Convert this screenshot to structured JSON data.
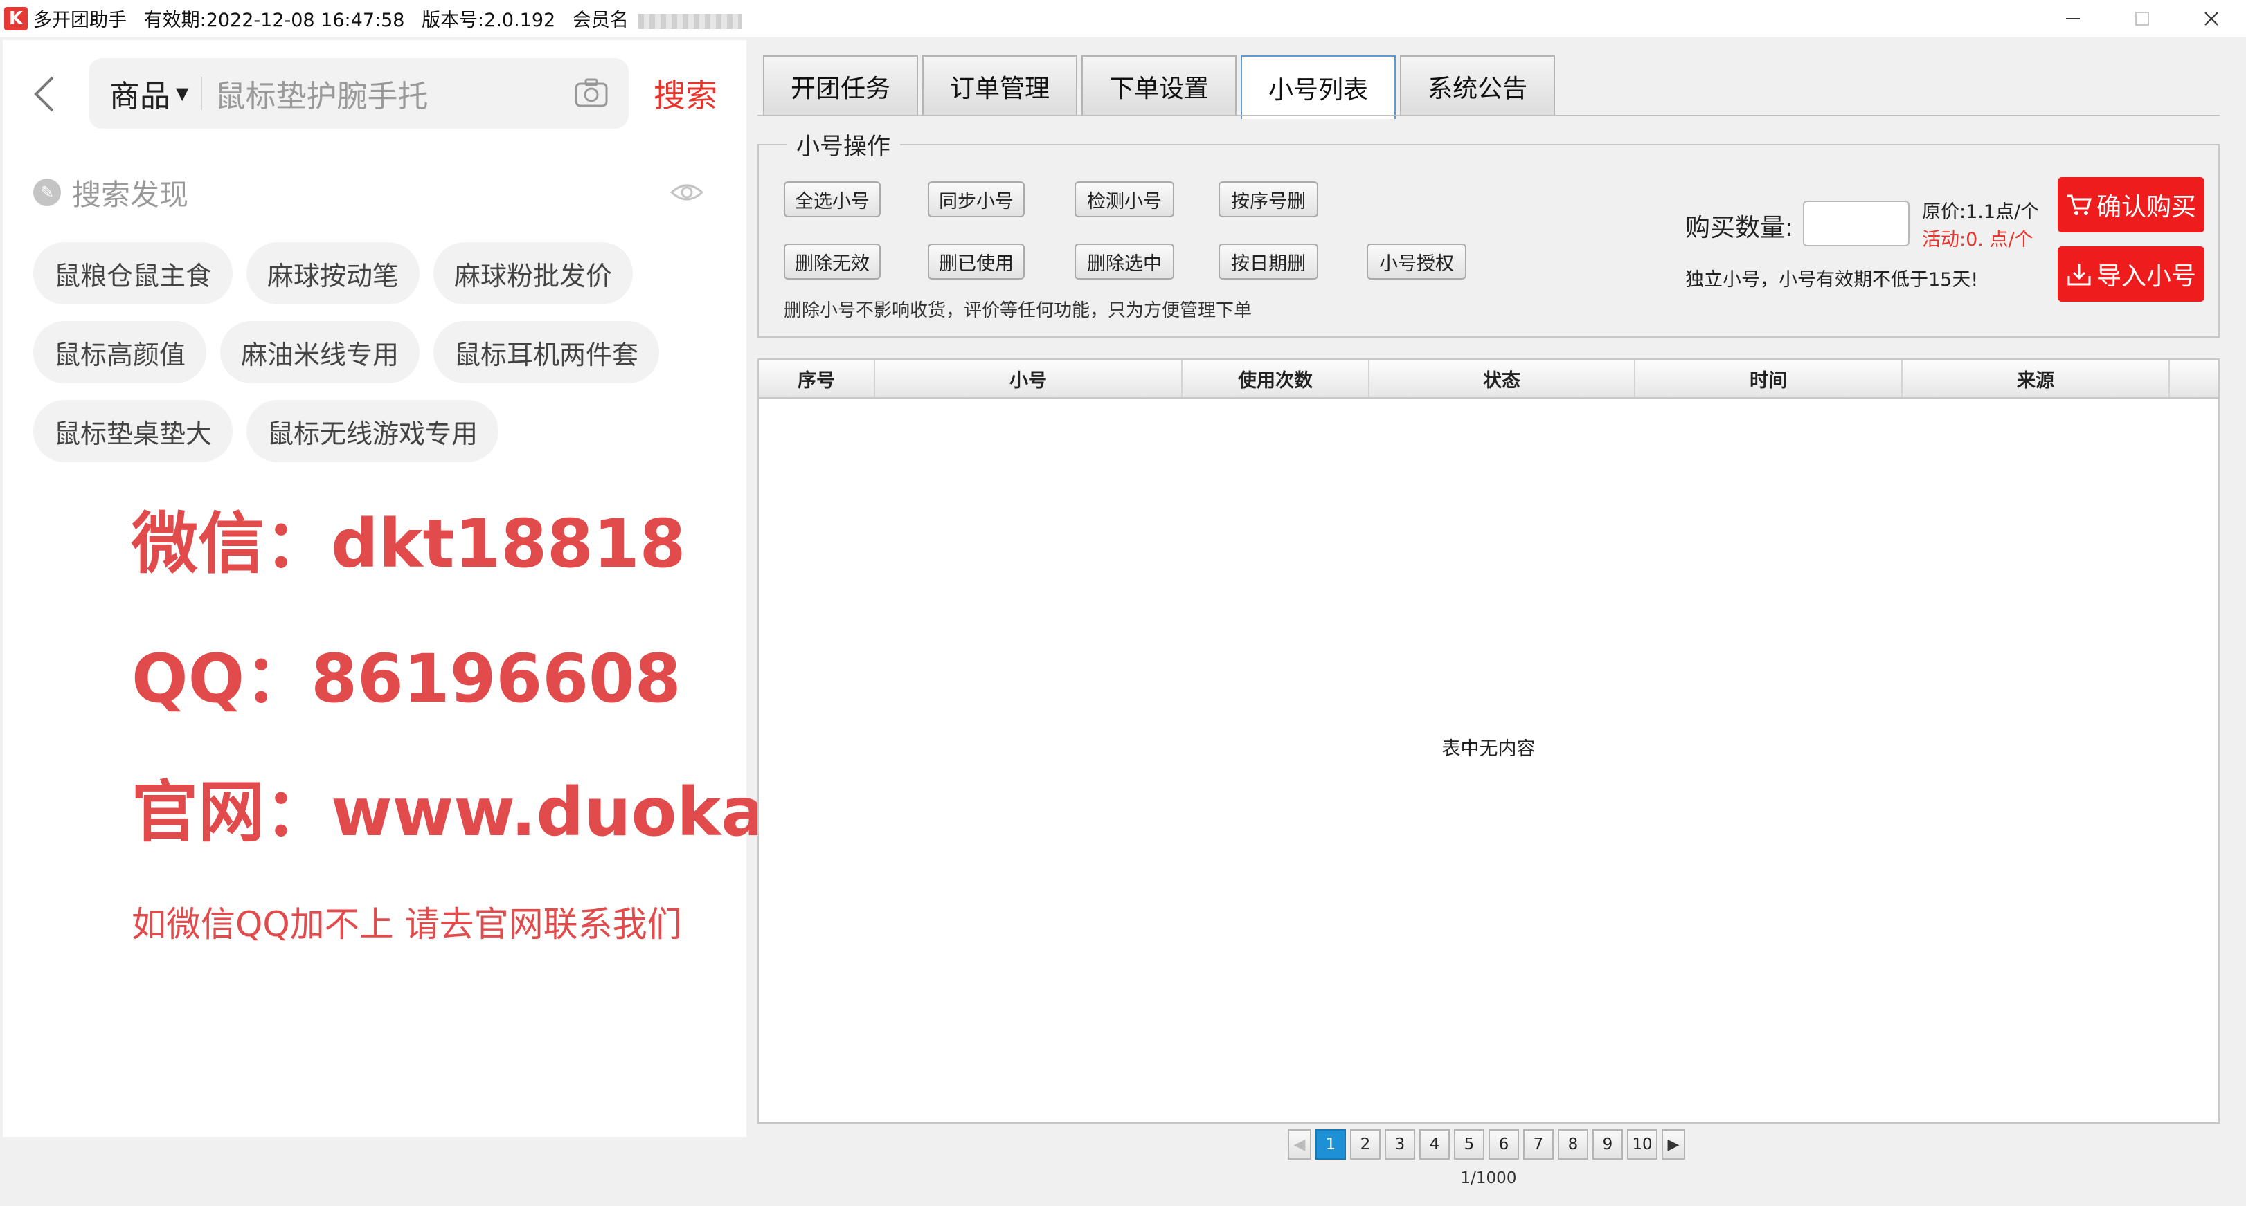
{
  "window": {
    "logo": "K",
    "app_name": "多开团助手",
    "expiry": "有效期:2022-12-08 16:47:58",
    "version": "版本号:2.0.192",
    "member_label": "会员名"
  },
  "left": {
    "category": "商品",
    "search_placeholder": "鼠标垫护腕手托",
    "search_button": "搜索",
    "discover_title": "搜索发现",
    "chips": [
      [
        "鼠粮仓鼠主食",
        "麻球按动笔",
        "麻球粉批发价"
      ],
      [
        "鼠标高颜值",
        "麻油米线专用",
        "鼠标耳机两件套"
      ],
      [
        "鼠标垫桌垫大",
        "鼠标无线游戏专用"
      ]
    ],
    "promo": {
      "wechat": "微信：dkt18818",
      "qq": "QQ：86196608",
      "site": "官网：www.duokaituan.com",
      "note": "如微信QQ加不上 请去官网联系我们"
    }
  },
  "tabs": [
    "开团任务",
    "订单管理",
    "下单设置",
    "小号列表",
    "系统公告"
  ],
  "active_tab": "小号列表",
  "ops": {
    "legend": "小号操作",
    "row1": [
      "全选小号",
      "同步小号",
      "检测小号",
      "按序号删"
    ],
    "row2": [
      "删除无效",
      "删已使用",
      "删除选中",
      "按日期删",
      "小号授权"
    ],
    "note": "删除小号不影响收货，评价等任何功能，只为方便管理下单",
    "qty_label": "购买数量:",
    "qty_value": "",
    "price_original": "原价:1.1点/个",
    "price_activity": "活动:0.  点/个",
    "info": "独立小号，小号有效期不低于15天!",
    "confirm_buy": "确认购买",
    "import": "导入小号"
  },
  "table": {
    "columns": [
      "序号",
      "小号",
      "使用次数",
      "状态",
      "时间",
      "来源"
    ],
    "rows": [],
    "empty_text": "表中无内容"
  },
  "pagination": {
    "pages": [
      "1",
      "2",
      "3",
      "4",
      "5",
      "6",
      "7",
      "8",
      "9",
      "10"
    ],
    "current": "1",
    "info": "1/1000"
  },
  "colors": {
    "accent_red": "#ee1c1c",
    "promo_red": "#e24b4b",
    "active_page": "#1e90d6"
  }
}
